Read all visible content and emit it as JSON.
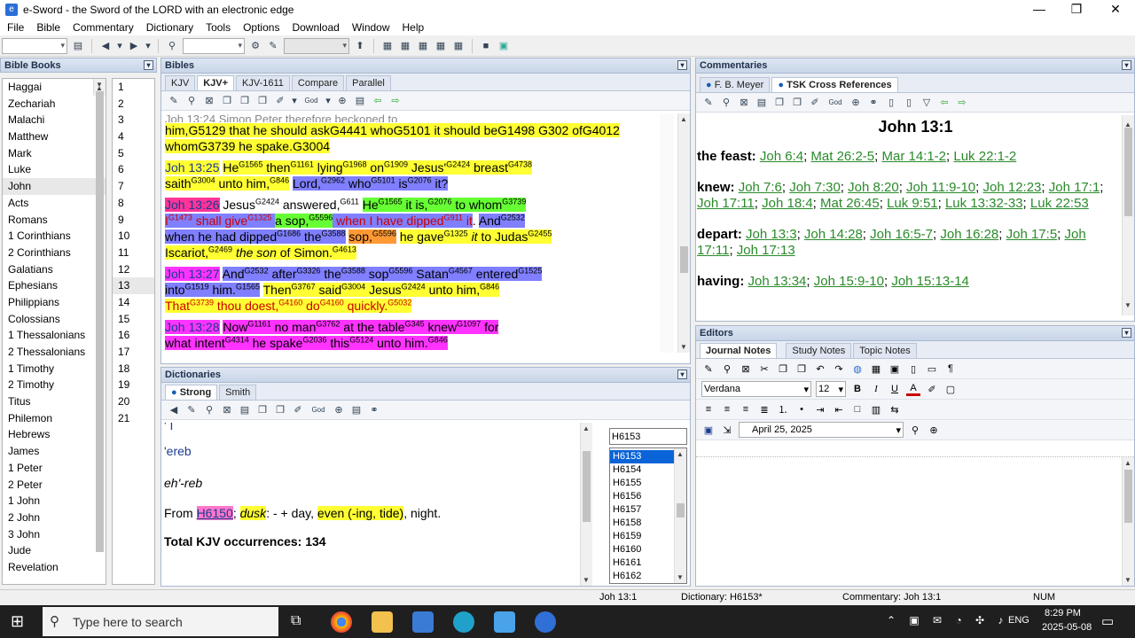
{
  "window": {
    "title": "e-Sword - the Sword of the LORD with an electronic edge",
    "app_icon": "sword-icon"
  },
  "menu": [
    "File",
    "Bible",
    "Commentary",
    "Dictionary",
    "Tools",
    "Options",
    "Download",
    "Window",
    "Help"
  ],
  "bible_books": {
    "header": "Bible Books",
    "books": [
      "Haggai",
      "Zechariah",
      "Malachi",
      "Matthew",
      "Mark",
      "Luke",
      "John",
      "Acts",
      "Romans",
      "1 Corinthians",
      "2 Corinthians",
      "Galatians",
      "Ephesians",
      "Philippians",
      "Colossians",
      "1 Thessalonians",
      "2 Thessalonians",
      "1 Timothy",
      "2 Timothy",
      "Titus",
      "Philemon",
      "Hebrews",
      "James",
      "1 Peter",
      "2 Peter",
      "1 John",
      "2 John",
      "3 John",
      "Jude",
      "Revelation"
    ],
    "selected_book": "John",
    "chapters": [
      "1",
      "2",
      "3",
      "4",
      "5",
      "6",
      "7",
      "8",
      "9",
      "10",
      "11",
      "12",
      "13",
      "14",
      "15",
      "16",
      "17",
      "18",
      "19",
      "20",
      "21"
    ],
    "selected_chapter": "13"
  },
  "bibles": {
    "header": "Bibles",
    "tabs": [
      "KJV",
      "KJV+",
      "KJV-1611",
      "Compare",
      "Parallel"
    ],
    "active_tab": "KJV+",
    "top_line": "him,G5129 that he should askG4441 whoG5101 it should beG1498 G302 ofG4012",
    "top_line2": "whomG3739 he spake.G3004",
    "v25_ref": "Joh 13:25",
    "v26_ref": "Joh 13:26",
    "v27_ref": "Joh 13:27",
    "v28_ref": "Joh 13:28"
  },
  "commentaries": {
    "header": "Commentaries",
    "tabs": [
      "F. B. Meyer",
      "TSK Cross References"
    ],
    "active_tab": "TSK Cross References",
    "heading": "John 13:1",
    "entries": [
      {
        "label": "the feast:",
        "refs": [
          "Joh 6:4",
          "Mat 26:2-5",
          "Mar 14:1-2",
          "Luk 22:1-2"
        ]
      },
      {
        "label": "knew:",
        "refs": [
          "Joh 7:6",
          "Joh 7:30",
          "Joh 8:20",
          "Joh 11:9-10",
          "Joh 12:23",
          "Joh 17:1",
          "Joh 17:11",
          "Joh 18:4",
          "Mat 26:45",
          "Luk 9:51",
          "Luk 13:32-33",
          "Luk 22:53"
        ]
      },
      {
        "label": "depart:",
        "refs": [
          "Joh 13:3",
          "Joh 14:28",
          "Joh 16:5-7",
          "Joh 16:28",
          "Joh 17:5",
          "Joh 17:11",
          "Joh 17:13"
        ]
      },
      {
        "label": "having:",
        "refs": [
          "Joh 13:34",
          "Joh 15:9-10",
          "Joh 15:13-14"
        ]
      }
    ]
  },
  "dictionaries": {
    "header": "Dictionaries",
    "tabs": [
      "Strong",
      "Smith"
    ],
    "active_tab": "Strong",
    "translit": "'ereb",
    "pron": "eh'-reb",
    "from_label": "From",
    "from_ref": "H6150",
    "def_word": "dusk",
    "def_rest": ": - + day,",
    "def_hl": "even (-ing, tide)",
    "def_end": ", night.",
    "total": "Total KJV occurrences: 134",
    "search_value": "H6153",
    "entries": [
      "H6153",
      "H6154",
      "H6155",
      "H6156",
      "H6157",
      "H6158",
      "H6159",
      "H6160",
      "H6161",
      "H6162"
    ],
    "selected_entry": "H6153"
  },
  "editors": {
    "header": "Editors",
    "tabs": [
      "Journal Notes",
      "Study Notes",
      "Topic Notes"
    ],
    "active_tab": "Journal Notes",
    "font": "Verdana",
    "size": "12",
    "date": "April    25, 2025",
    "bold": "B",
    "italic": "I",
    "underline": "U"
  },
  "status": {
    "verse": "Joh 13:1",
    "dictionary": "Dictionary: H6153*",
    "commentary": "Commentary: Joh 13:1",
    "num": "NUM"
  },
  "taskbar": {
    "search_placeholder": "Type here to search",
    "time": "8:29 PM",
    "date": "2025-05-08",
    "lang": "ENG"
  }
}
